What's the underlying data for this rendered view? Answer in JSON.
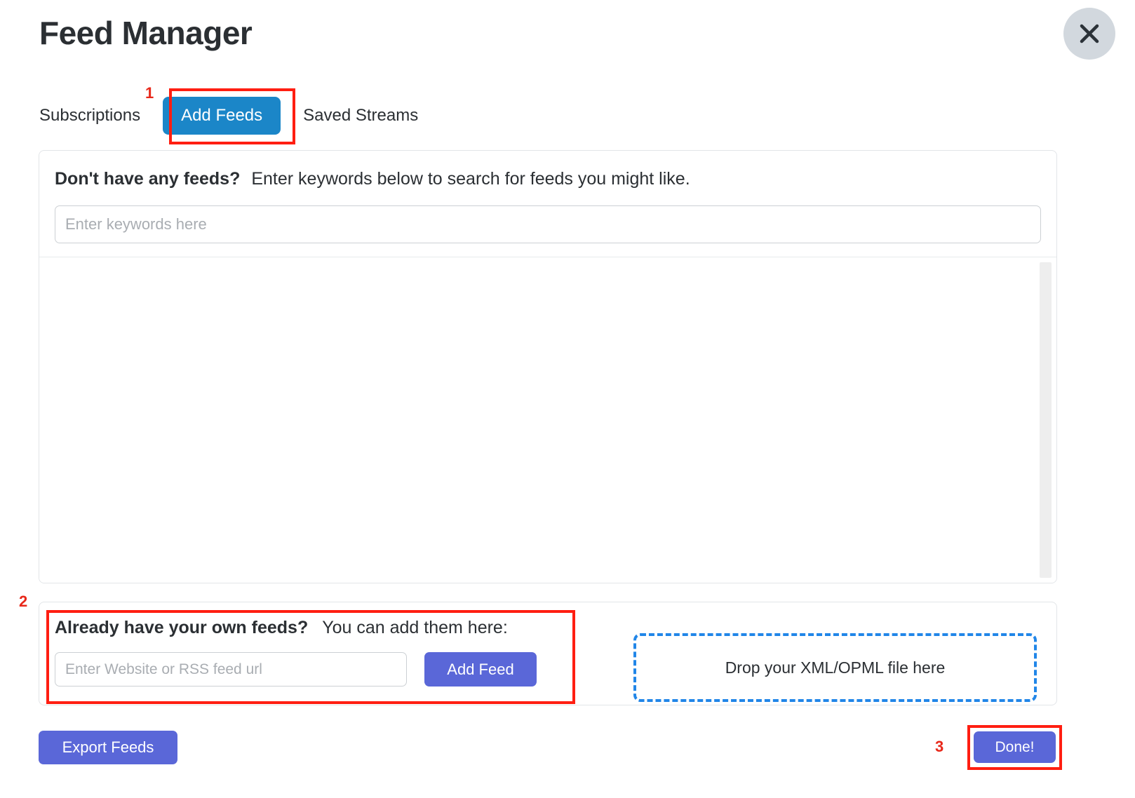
{
  "window": {
    "title": "Feed Manager",
    "close_icon": "close-icon"
  },
  "tabs": [
    {
      "label": "Subscriptions",
      "active": false
    },
    {
      "label": "Add Feeds",
      "active": true
    },
    {
      "label": "Saved Streams",
      "active": false
    }
  ],
  "search_section": {
    "heading_strong": "Don't have any feeds?",
    "heading_rest": "Enter keywords below to search for feeds you might like.",
    "input_placeholder": "Enter keywords here",
    "input_value": "",
    "results": []
  },
  "own_feeds_section": {
    "heading_strong": "Already have your own feeds?",
    "heading_rest": "You can add them here:",
    "url_placeholder": "Enter Website or RSS feed url",
    "url_value": "",
    "add_feed_label": "Add Feed",
    "dropzone_label": "Drop your XML/OPML file here"
  },
  "footer": {
    "export_label": "Export Feeds",
    "done_label": "Done!"
  },
  "annotations": {
    "step1": "1",
    "step2": "2",
    "step3": "3"
  },
  "colors": {
    "tab_active_blue": "#1b86c8",
    "button_purple": "#5a67d8",
    "dropzone_blue": "#2186e8",
    "highlight_red": "#ff1e11",
    "marker_red": "#e8281a",
    "close_button_gray": "#d2d8de",
    "card_border": "#e2e5e8",
    "input_border": "#ccd0d4",
    "placeholder_gray": "#a9adb2",
    "scrollbar_track": "#eeeeee",
    "text_primary": "#2b2f33"
  }
}
